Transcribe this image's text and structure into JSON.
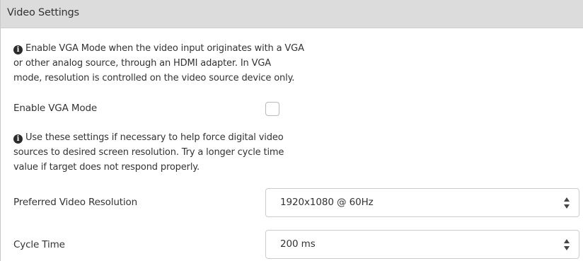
{
  "panel": {
    "title": "Video Settings"
  },
  "vga": {
    "info_text": "Enable VGA Mode when the video input originates with a VGA or other analog source, through an HDMI adapter. In VGA mode, resolution is controlled on the video source device only.",
    "info_lines": [
      "Enable VGA Mode when the video input originates with a VGA",
      "or other analog source, through an HDMI adapter. In VGA",
      "mode, resolution is controlled on the video source device only."
    ],
    "label": "Enable VGA Mode",
    "checked": false
  },
  "digital": {
    "info_lines": [
      "Use these settings if necessary to help force digital video",
      "sources to desired screen resolution. Try a longer cycle time",
      "value if target does not respond properly."
    ]
  },
  "resolution": {
    "label": "Preferred Video Resolution",
    "value": "1920x1080 @ 60Hz"
  },
  "cycle": {
    "label": "Cycle Time",
    "value": "200 ms"
  },
  "icons": {
    "info": "info-circle-icon",
    "select_arrows": "sort-arrows-icon"
  },
  "colors": {
    "header_bg": "#dcdcdc",
    "text": "#333333",
    "border": "#cccccc"
  }
}
